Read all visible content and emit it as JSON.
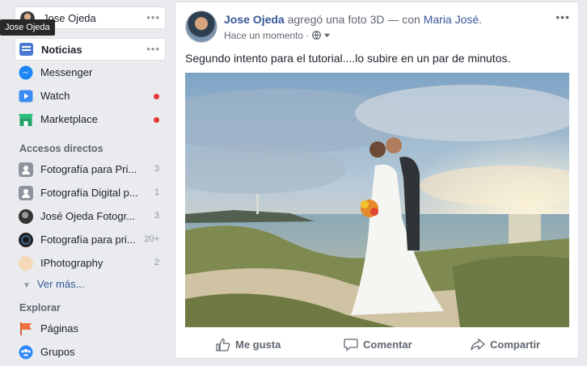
{
  "sidebar": {
    "profile_name": "Jose Ojeda",
    "tooltip": "Jose Ojeda",
    "news_label": "Noticias",
    "items": [
      {
        "label": "Messenger",
        "icon": "messenger-icon",
        "dot": false
      },
      {
        "label": "Watch",
        "icon": "watch-icon",
        "dot": true
      },
      {
        "label": "Marketplace",
        "icon": "marketplace-icon",
        "dot": true
      }
    ],
    "shortcuts_title": "Accesos directos",
    "shortcuts": [
      {
        "label": "Fotografía para Pri...",
        "count": "3",
        "icon": "group-icon"
      },
      {
        "label": "Fotografía Digital p...",
        "count": "1",
        "icon": "group-icon"
      },
      {
        "label": "José Ojeda Fotogr...",
        "count": "3",
        "icon": "page-photo-icon"
      },
      {
        "label": "Fotografía para pri...",
        "count": "20+",
        "icon": "lens-icon"
      },
      {
        "label": "IPhotography",
        "count": "2",
        "icon": "page-icon"
      }
    ],
    "see_more": "Ver más...",
    "explore_title": "Explorar",
    "explore": [
      {
        "label": "Páginas",
        "icon": "flag-icon"
      },
      {
        "label": "Grupos",
        "icon": "groups-icon"
      }
    ]
  },
  "post": {
    "author": "Jose Ojeda",
    "action": " agregó una foto 3D — con ",
    "tagged": "Maria José",
    "end": ".",
    "time": "Hace un momento",
    "separator": "·",
    "text": "Segundo intento para el tutorial....lo subire en un par de minutos.",
    "like": "Me gusta",
    "comment": "Comentar",
    "share": "Compartir"
  },
  "colors": {
    "link": "#385898",
    "background": "#e9ebee",
    "notification_dot": "#e53935"
  }
}
